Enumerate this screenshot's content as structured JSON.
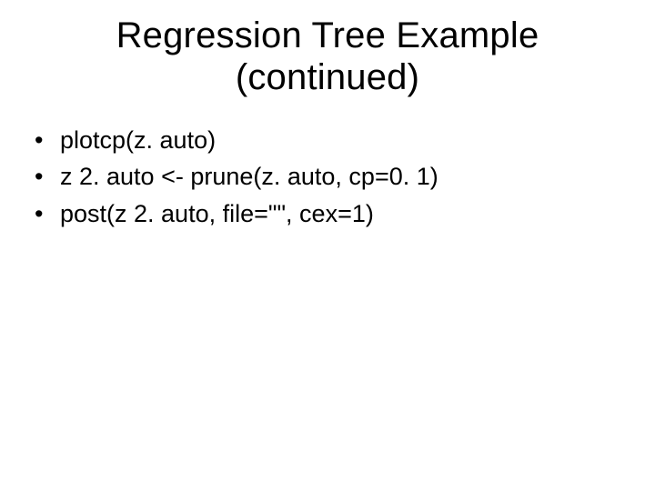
{
  "title_line1": "Regression Tree Example",
  "title_line2": "(continued)",
  "bullets": [
    "plotcp(z. auto)",
    "z 2. auto <- prune(z. auto, cp=0. 1)",
    "post(z 2. auto, file=\"\", cex=1)"
  ]
}
